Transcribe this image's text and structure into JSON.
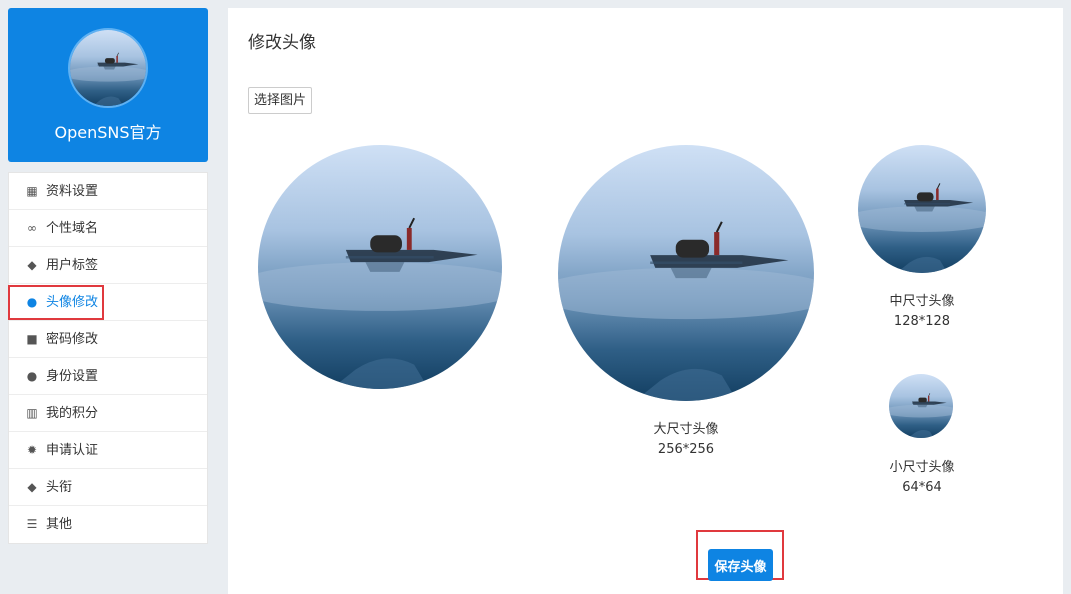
{
  "profile": {
    "name": "OpenSNS官方"
  },
  "menu": {
    "items": [
      {
        "label": "资料设置",
        "icon": "grid-icon",
        "glyph": "▦",
        "active": false
      },
      {
        "label": "个性域名",
        "icon": "link-icon",
        "glyph": "∞",
        "active": false
      },
      {
        "label": "用户标签",
        "icon": "tag-icon",
        "glyph": "◆",
        "active": false
      },
      {
        "label": "头像修改",
        "icon": "user-icon",
        "glyph": "●",
        "active": true
      },
      {
        "label": "密码修改",
        "icon": "lock-icon",
        "glyph": "■",
        "active": false
      },
      {
        "label": "身份设置",
        "icon": "users-icon",
        "glyph": "●",
        "active": false
      },
      {
        "label": "我的积分",
        "icon": "bar-chart-icon",
        "glyph": "▥",
        "active": false
      },
      {
        "label": "申请认证",
        "icon": "badge-icon",
        "glyph": "✹",
        "active": false
      },
      {
        "label": "头衔",
        "icon": "tags-icon",
        "glyph": "◆",
        "active": false
      },
      {
        "label": "其他",
        "icon": "list-icon",
        "glyph": "☰",
        "active": false
      }
    ]
  },
  "main": {
    "title": "修改头像",
    "choose_button": "选择图片",
    "previews": {
      "large": {
        "label": "大尺寸头像",
        "size": "256*256"
      },
      "medium": {
        "label": "中尺寸头像",
        "size": "128*128"
      },
      "small": {
        "label": "小尺寸头像",
        "size": "64*64"
      }
    },
    "save_button": "保存头像"
  },
  "colors": {
    "accent": "#0e84e3",
    "highlight_outline": "#e0393e",
    "page_bg": "#e9edf1"
  }
}
